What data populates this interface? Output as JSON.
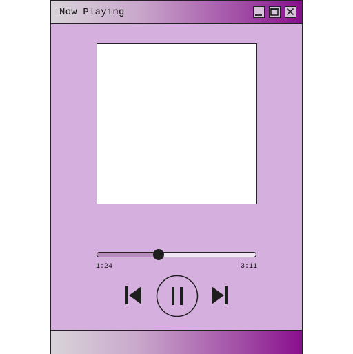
{
  "window": {
    "title": "Now Playing"
  },
  "player": {
    "elapsed": "1:24",
    "total": "3:11",
    "progress_fraction": 0.385,
    "state": "playing"
  },
  "icons": {
    "minimize": "minimize-icon",
    "maximize": "maximize-icon",
    "close": "close-icon",
    "previous": "skip-previous-icon",
    "pause": "pause-icon",
    "next": "skip-next-icon"
  },
  "colors": {
    "window_bg": "#d5afdd",
    "gradient_start": "#d9d4d9",
    "gradient_end": "#8a0e8f",
    "progress_fill": "#b98ac0",
    "knob": "#1e1e1e"
  }
}
